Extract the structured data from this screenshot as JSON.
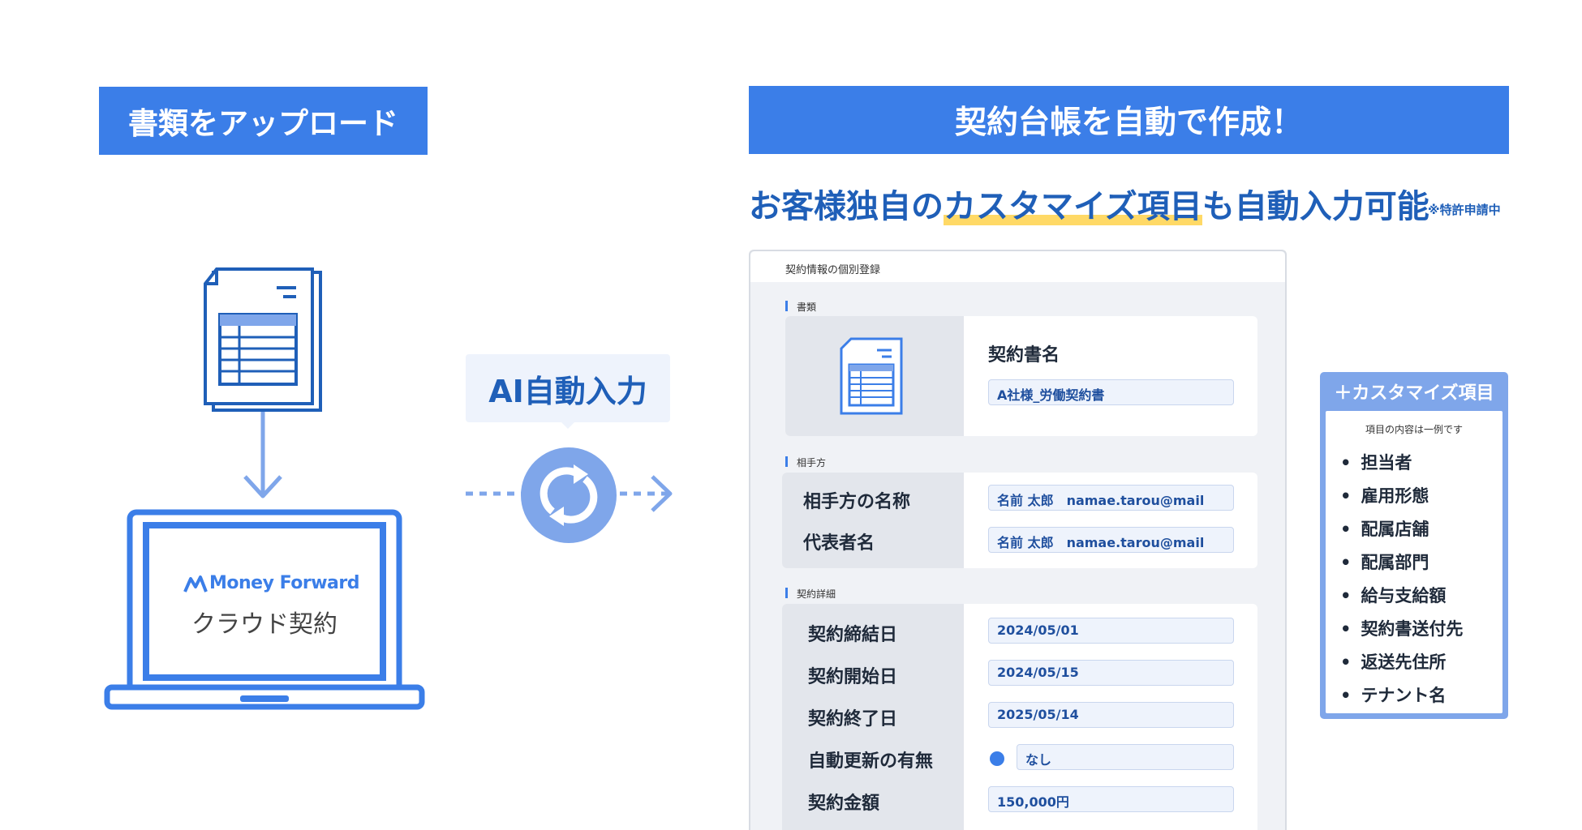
{
  "left_banner": "書類をアップロード",
  "right_banner": "契約台帳を自動で作成！",
  "ai_label": "AI自動入力",
  "headline": {
    "before": "お客様独自の",
    "highlight": "カスタマイズ項目",
    "after": "も自動入力可能"
  },
  "patent_note": "※特許申請中",
  "laptop": {
    "brand": "Money Forward",
    "product": "クラウド契約"
  },
  "form": {
    "title": "契約情報の個別登録",
    "sections": {
      "document": "書類",
      "counterparty": "相手方",
      "details": "契約詳細"
    },
    "document_name_label": "契約書名",
    "document_name_value": "A社様_労働契約書",
    "counterparty_rows": [
      {
        "label": "相手方の名称",
        "value": "名前 太郎　namae.tarou@mail"
      },
      {
        "label": "代表者名",
        "value": "名前 太郎　namae.tarou@mail"
      }
    ],
    "detail_rows": [
      {
        "label": "契約締結日",
        "value": "2024/05/01"
      },
      {
        "label": "契約開始日",
        "value": "2024/05/15"
      },
      {
        "label": "契約終了日",
        "value": "2025/05/14"
      },
      {
        "label": "自動更新の有無",
        "value": "なし"
      },
      {
        "label": "契約金額",
        "value": "150,000円"
      }
    ]
  },
  "custom": {
    "title": "＋カスタマイズ項目",
    "note": "項目の内容は一例です",
    "items": [
      "担当者",
      "雇用形態",
      "配属店舗",
      "配属部門",
      "給与支給額",
      "契約書送付先",
      "返送先住所",
      "テナント名"
    ]
  },
  "colors": {
    "accent": "#3b7ee8",
    "accent_light": "#7fa6ea",
    "headline": "#1f5fb8",
    "highlight": "#ffd966"
  }
}
